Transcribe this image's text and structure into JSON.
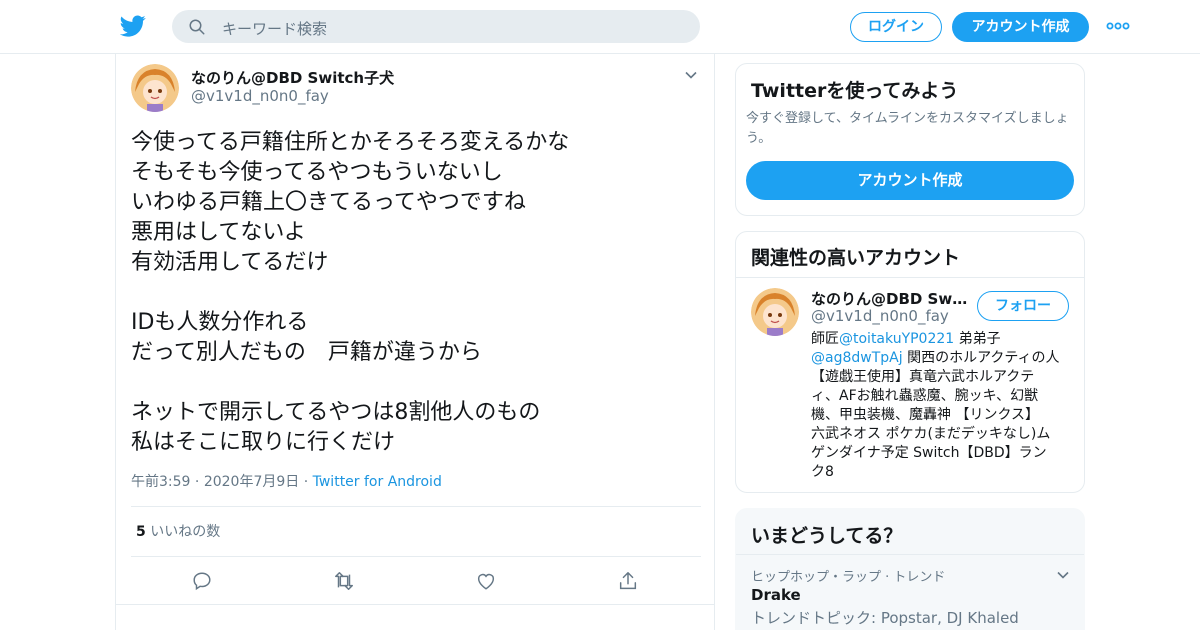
{
  "header": {
    "search_placeholder": "キーワード検索",
    "login_label": "ログイン",
    "signup_label": "アカウント作成",
    "brand_color": "#1da1f2"
  },
  "tweet": {
    "name": "なのりん@DBD Switch子犬",
    "handle": "@v1v1d_n0n0_fay",
    "lines": [
      "今使ってる戸籍住所とかそろそろ変えるかな",
      "そもそも今使ってるやつもういないし",
      "いわゆる戸籍上〇きてるってやつですね",
      "悪用はしてないよ",
      "有効活用してるだけ",
      "",
      "IDも人数分作れる",
      "だって別人だもの　戸籍が違うから",
      "",
      "ネットで開示してるやつは8割他人のもの",
      "私はそこに取りに行くだけ"
    ],
    "time": "午前3:59",
    "date": "2020年7月9日",
    "source": "Twitter for Android",
    "like_count": "5",
    "like_label": "いいねの数",
    "actions": [
      "reply-icon",
      "retweet-icon",
      "like-icon",
      "share-icon"
    ]
  },
  "signup_card": {
    "title": "Twitterを使ってみよう",
    "description": "今すぐ登録して、タイムラインをカスタマイズしましょう。",
    "button": "アカウント作成"
  },
  "related": {
    "title": "関連性の高いアカウント",
    "name": "なのりん@DBD Switch子犬",
    "handle": "@v1v1d_n0n0_fay",
    "follow_label": "フォロー",
    "bio": {
      "line1_prefix": "師匠",
      "line1_mention": "@toitakuYP0221",
      "line1_suffix": " 弟弟子",
      "line2_mention": "@ag8dwTpAj",
      "line2_suffix": " 関西のホルアクティの人",
      "lines": [
        "【遊戯王使用】真竜六武ホルアクテ",
        "ィ、AFお触れ蟲惑魔、腕ッキ、幻獣",
        "機、甲虫装機、魔轟神 【リンクス】",
        "六武ネオス ポケカ(まだデッキなし)ム",
        "ゲンダイナ予定 Switch【DBD】ラン",
        "ク8"
      ]
    }
  },
  "trends": {
    "title": "いまどうしてる？",
    "meta": "ヒップホップ・ラップ · トレンド",
    "name": "Drake",
    "topic": "トレンドトピック: Popstar, DJ Khaled"
  }
}
